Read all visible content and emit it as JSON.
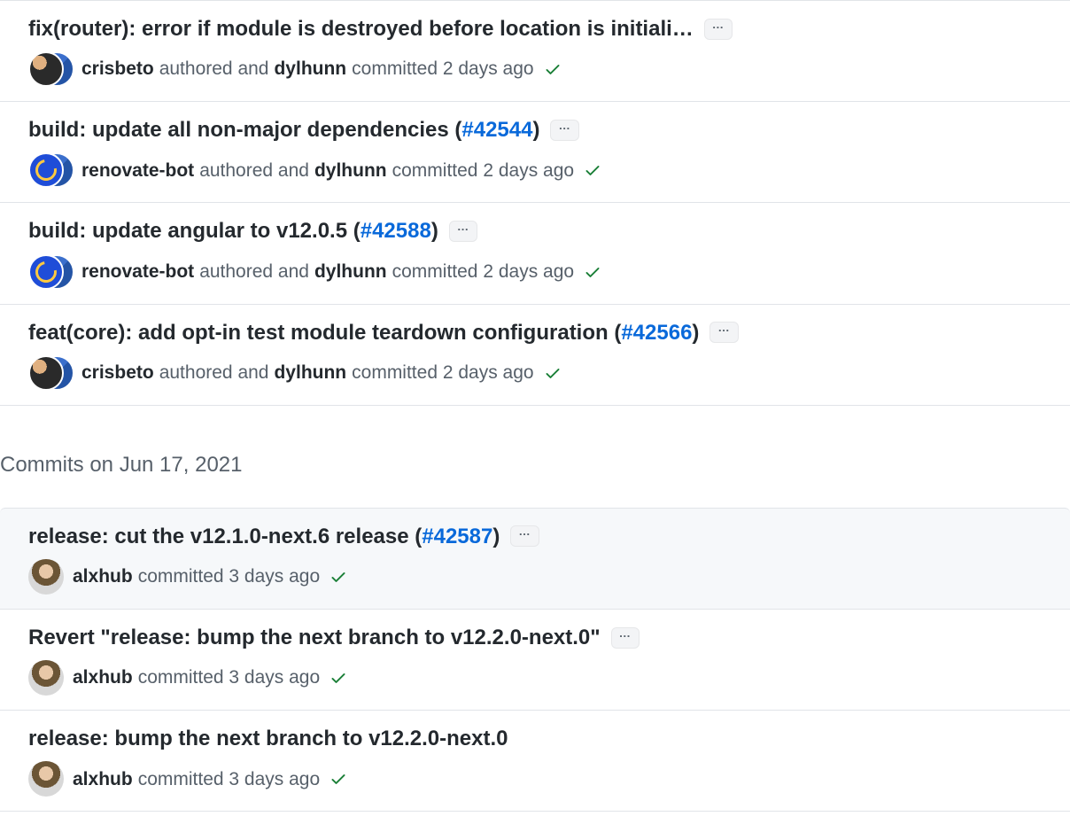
{
  "group1": {
    "commits": [
      {
        "title": "fix(router): error if module is destroyed before location is initiali…",
        "pr": null,
        "author1": "crisbeto",
        "middle": "authored and",
        "author2": "dylhunn",
        "tail": "committed 2 days ago",
        "avatars": [
          "crisbeto",
          "dylhunn"
        ],
        "ellipsis": true,
        "check": true,
        "highlight": false
      },
      {
        "title": "build: update all non-major dependencies (",
        "pr": "#42544",
        "title_tail": ")",
        "author1": "renovate-bot",
        "middle": "authored and",
        "author2": "dylhunn",
        "tail": "committed 2 days ago",
        "avatars": [
          "renovate",
          "dylhunn"
        ],
        "ellipsis": true,
        "check": true,
        "highlight": false
      },
      {
        "title": "build: update angular to v12.0.5 (",
        "pr": "#42588",
        "title_tail": ")",
        "author1": "renovate-bot",
        "middle": "authored and",
        "author2": "dylhunn",
        "tail": "committed 2 days ago",
        "avatars": [
          "renovate",
          "dylhunn"
        ],
        "ellipsis": true,
        "check": true,
        "highlight": false
      },
      {
        "title": "feat(core): add opt-in test module teardown configuration (",
        "pr": "#42566",
        "title_tail": ")",
        "author1": "crisbeto",
        "middle": "authored and",
        "author2": "dylhunn",
        "tail": "committed 2 days ago",
        "avatars": [
          "crisbeto",
          "dylhunn"
        ],
        "ellipsis": true,
        "check": true,
        "highlight": false
      }
    ]
  },
  "date_heading": "Commits on Jun 17, 2021",
  "group2": {
    "commits": [
      {
        "title": "release: cut the v12.1.0-next.6 release (",
        "pr": "#42587",
        "title_tail": ")",
        "author1": "alxhub",
        "middle": "",
        "author2": null,
        "tail": "committed 3 days ago",
        "avatars": [
          "alxhub"
        ],
        "ellipsis": true,
        "check": true,
        "highlight": true
      },
      {
        "title": "Revert \"release: bump the next branch to v12.2.0-next.0\"",
        "pr": null,
        "author1": "alxhub",
        "middle": "",
        "author2": null,
        "tail": "committed 3 days ago",
        "avatars": [
          "alxhub"
        ],
        "ellipsis": true,
        "check": true,
        "highlight": false
      },
      {
        "title": "release: bump the next branch to v12.2.0-next.0",
        "pr": null,
        "author1": "alxhub",
        "middle": "",
        "author2": null,
        "tail": "committed 3 days ago",
        "avatars": [
          "alxhub"
        ],
        "ellipsis": false,
        "check": true,
        "highlight": false
      }
    ]
  }
}
